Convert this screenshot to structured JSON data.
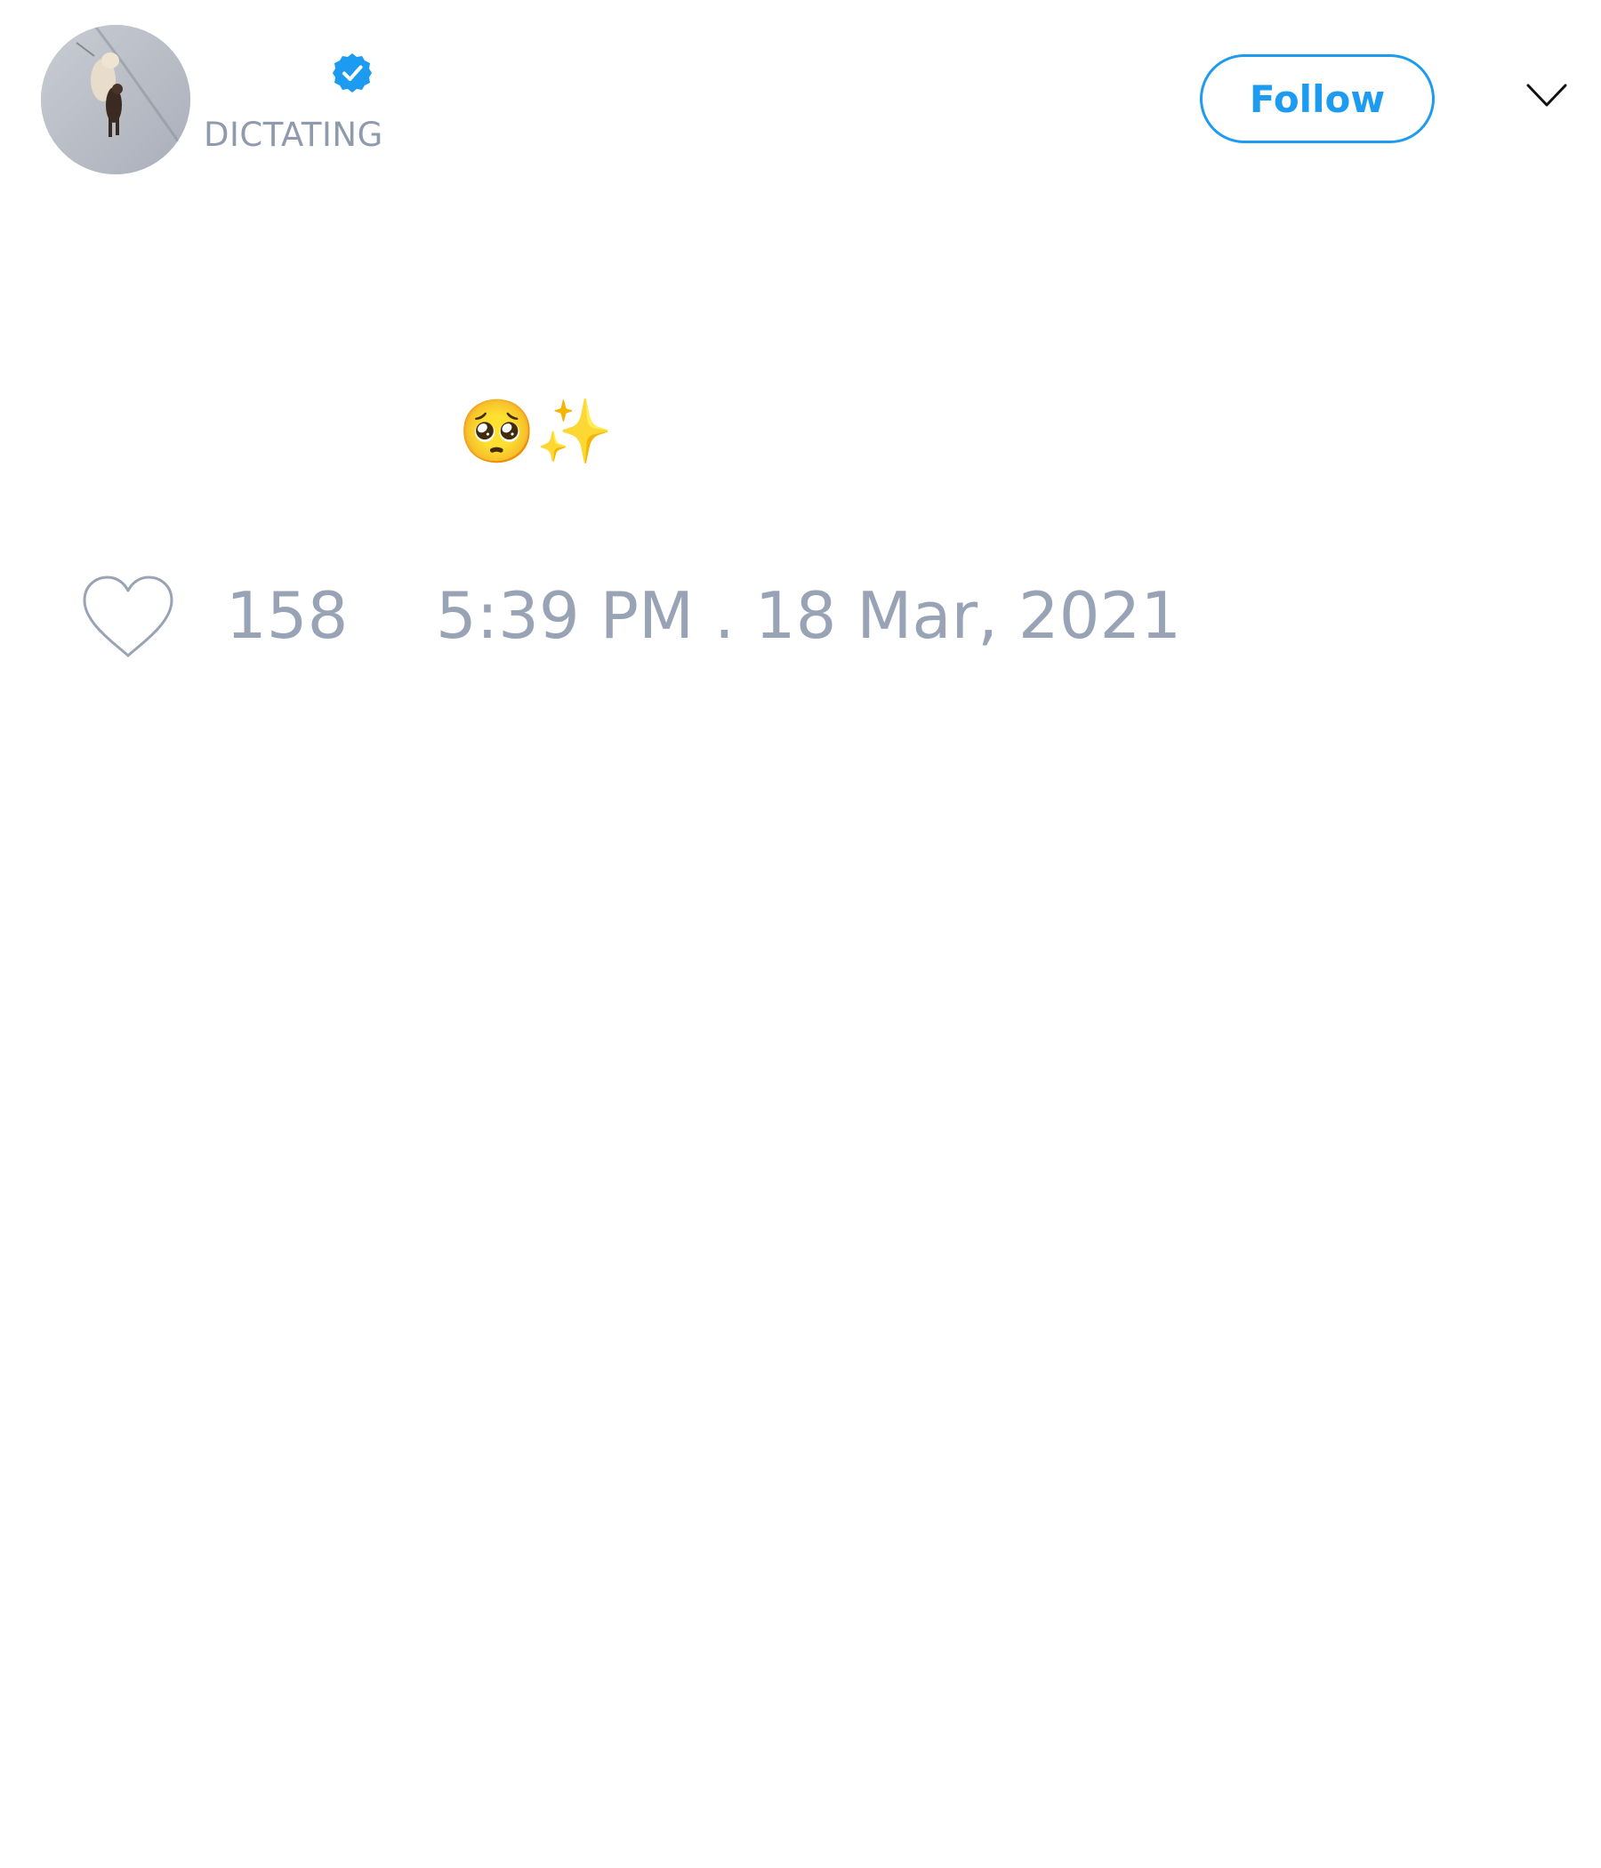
{
  "header": {
    "handle": "DICTATING",
    "follow_label": "Follow",
    "accent_color": "#1d9bf0",
    "avatar_icon": "dog-photo-avatar",
    "verified_icon": "verified-badge-icon",
    "menu_icon": "chevron-down-icon"
  },
  "tweet": {
    "text": "🥺✨"
  },
  "footer": {
    "like_icon": "heart-outline-icon",
    "like_count": "158",
    "timestamp": "5:39 PM . 18 Mar, 2021",
    "meta_color": "#98a4b6"
  }
}
